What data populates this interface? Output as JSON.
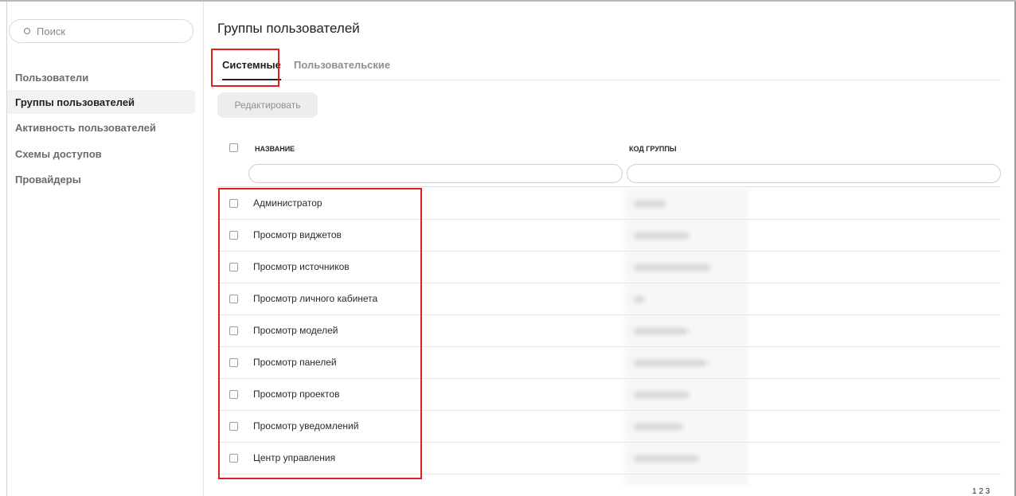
{
  "sidebar": {
    "search_placeholder": "Поиск",
    "items": [
      {
        "label": "Пользователи"
      },
      {
        "label": "Группы пользователей",
        "active": true
      },
      {
        "label": "Активность пользователей"
      },
      {
        "label": "Схемы доступов"
      },
      {
        "label": "Провайдеры"
      }
    ]
  },
  "main": {
    "title": "Группы пользователей",
    "tabs": [
      {
        "label": "Системные",
        "active": true
      },
      {
        "label": "Пользовательские"
      }
    ],
    "edit_button": "Редактировать",
    "table": {
      "columns": [
        "НАЗВАНИЕ",
        "КОД ГРУППЫ"
      ],
      "rows": [
        {
          "name": "Администратор"
        },
        {
          "name": "Просмотр виджетов"
        },
        {
          "name": "Просмотр источников"
        },
        {
          "name": "Просмотр личного кабинета"
        },
        {
          "name": "Просмотр моделей"
        },
        {
          "name": "Просмотр панелей"
        },
        {
          "name": "Просмотр проектов"
        },
        {
          "name": "Просмотр уведомлений"
        },
        {
          "name": "Центр управления"
        }
      ]
    },
    "pagination_text": "1  2  3"
  },
  "colors": {
    "highlight": "#e02020",
    "active_bg": "#f2f2f2",
    "muted_text": "#8f8f8f"
  }
}
